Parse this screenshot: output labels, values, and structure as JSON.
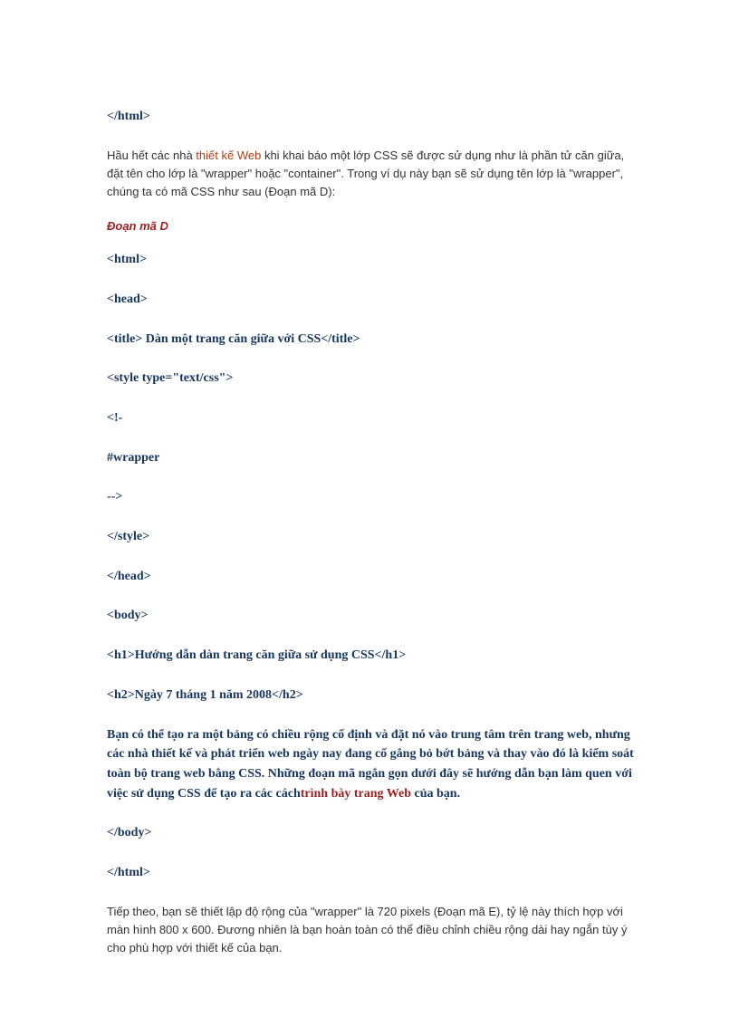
{
  "code1": "</html>",
  "para1_pre": "Hầu hết các nhà ",
  "para1_link": "thiết kế Web",
  "para1_post": " khi khai báo một lớp CSS sẽ được sử dụng như là phần tử căn giữa, đặt tên cho lớp là \"wrapper\" hoặc \"container\". Trong ví dụ này bạn sẽ sử dụng tên lớp là \"wrapper\",  chúng ta có mã CSS như sau (Đoạn mã D):",
  "heading": "Đoạn mã D",
  "c_html": "<html>",
  "c_head": "<head>",
  "c_title": "<title> Dàn một trang căn giữa với CSS</title>",
  "c_style": "<style type=\"text/css\">",
  "c_comment_open": "<!-",
  "c_wrapper": "#wrapper",
  "c_comment_close": "-->",
  "c_style_close": "</style>",
  "c_head_close": "</head>",
  "c_body": "<body>",
  "c_h1": "<h1>Hướng dẫn dàn trang căn giữa sử dụng CSS</h1>",
  "c_h2": "<h2>Ngày 7 tháng 1 năm 2008</h2>",
  "bp_pre": "Bạn có thể tạo ra một bảng có chiều rộng cố định và đặt nó vào trung tâm trên trang web, nhưng các nhà thiết kế và phát triển web ngày nay đang cố gắng bỏ bớt bảng và thay vào đó là kiểm soát toàn bộ trang web bằng CSS. Những đoạn mã ngắn gọn dưới đây sẽ hướng dẫn bạn làm quen với việc sử dụng CSS để tạo ra các cách",
  "bp_link": "trình bày trang Web",
  "bp_post": " của bạn.",
  "c_body_close": "</body>",
  "c_html_close": "</html>",
  "para2": "Tiếp theo, bạn sẽ thiết lập độ rộng của \"wrapper\"  là 720 pixels (Đoạn mã E), tỷ lệ này thích hợp với màn hình 800 x 600. Đương nhiên là bạn hoàn toàn có thể điều chỉnh chiều rộng dài hay ngắn tùy ý cho phù hợp với thiết kế của bạn."
}
